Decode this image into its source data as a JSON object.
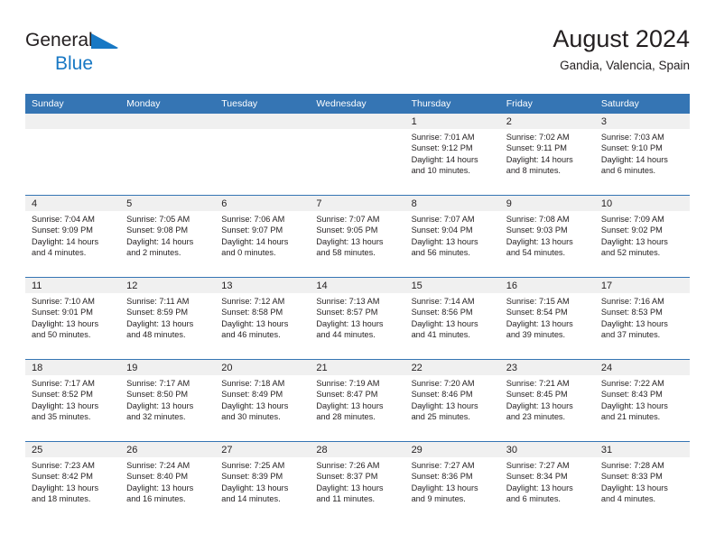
{
  "brand": {
    "name_part1": "General",
    "name_part2": "Blue",
    "triangle_icon": "blue-triangle-icon",
    "color_dark": "#231f20",
    "color_blue": "#1878c4"
  },
  "header": {
    "title": "August 2024",
    "subtitle": "Gandia, Valencia, Spain"
  },
  "theme": {
    "header_blue": "#3575b4",
    "date_strip_gray": "#f0f0f0",
    "text": "#231f20"
  },
  "weekdays": [
    "Sunday",
    "Monday",
    "Tuesday",
    "Wednesday",
    "Thursday",
    "Friday",
    "Saturday"
  ],
  "labels": {
    "sunrise": "Sunrise:",
    "sunset": "Sunset:",
    "daylight": "Daylight:"
  },
  "weeks": [
    [
      {
        "day": "",
        "empty": true
      },
      {
        "day": "",
        "empty": true
      },
      {
        "day": "",
        "empty": true
      },
      {
        "day": "",
        "empty": true
      },
      {
        "day": "1",
        "sunrise": "Sunrise: 7:01 AM",
        "sunset": "Sunset: 9:12 PM",
        "daylight_l1": "Daylight: 14 hours",
        "daylight_l2": "and 10 minutes."
      },
      {
        "day": "2",
        "sunrise": "Sunrise: 7:02 AM",
        "sunset": "Sunset: 9:11 PM",
        "daylight_l1": "Daylight: 14 hours",
        "daylight_l2": "and 8 minutes."
      },
      {
        "day": "3",
        "sunrise": "Sunrise: 7:03 AM",
        "sunset": "Sunset: 9:10 PM",
        "daylight_l1": "Daylight: 14 hours",
        "daylight_l2": "and 6 minutes."
      }
    ],
    [
      {
        "day": "4",
        "sunrise": "Sunrise: 7:04 AM",
        "sunset": "Sunset: 9:09 PM",
        "daylight_l1": "Daylight: 14 hours",
        "daylight_l2": "and 4 minutes."
      },
      {
        "day": "5",
        "sunrise": "Sunrise: 7:05 AM",
        "sunset": "Sunset: 9:08 PM",
        "daylight_l1": "Daylight: 14 hours",
        "daylight_l2": "and 2 minutes."
      },
      {
        "day": "6",
        "sunrise": "Sunrise: 7:06 AM",
        "sunset": "Sunset: 9:07 PM",
        "daylight_l1": "Daylight: 14 hours",
        "daylight_l2": "and 0 minutes."
      },
      {
        "day": "7",
        "sunrise": "Sunrise: 7:07 AM",
        "sunset": "Sunset: 9:05 PM",
        "daylight_l1": "Daylight: 13 hours",
        "daylight_l2": "and 58 minutes."
      },
      {
        "day": "8",
        "sunrise": "Sunrise: 7:07 AM",
        "sunset": "Sunset: 9:04 PM",
        "daylight_l1": "Daylight: 13 hours",
        "daylight_l2": "and 56 minutes."
      },
      {
        "day": "9",
        "sunrise": "Sunrise: 7:08 AM",
        "sunset": "Sunset: 9:03 PM",
        "daylight_l1": "Daylight: 13 hours",
        "daylight_l2": "and 54 minutes."
      },
      {
        "day": "10",
        "sunrise": "Sunrise: 7:09 AM",
        "sunset": "Sunset: 9:02 PM",
        "daylight_l1": "Daylight: 13 hours",
        "daylight_l2": "and 52 minutes."
      }
    ],
    [
      {
        "day": "11",
        "sunrise": "Sunrise: 7:10 AM",
        "sunset": "Sunset: 9:01 PM",
        "daylight_l1": "Daylight: 13 hours",
        "daylight_l2": "and 50 minutes."
      },
      {
        "day": "12",
        "sunrise": "Sunrise: 7:11 AM",
        "sunset": "Sunset: 8:59 PM",
        "daylight_l1": "Daylight: 13 hours",
        "daylight_l2": "and 48 minutes."
      },
      {
        "day": "13",
        "sunrise": "Sunrise: 7:12 AM",
        "sunset": "Sunset: 8:58 PM",
        "daylight_l1": "Daylight: 13 hours",
        "daylight_l2": "and 46 minutes."
      },
      {
        "day": "14",
        "sunrise": "Sunrise: 7:13 AM",
        "sunset": "Sunset: 8:57 PM",
        "daylight_l1": "Daylight: 13 hours",
        "daylight_l2": "and 44 minutes."
      },
      {
        "day": "15",
        "sunrise": "Sunrise: 7:14 AM",
        "sunset": "Sunset: 8:56 PM",
        "daylight_l1": "Daylight: 13 hours",
        "daylight_l2": "and 41 minutes."
      },
      {
        "day": "16",
        "sunrise": "Sunrise: 7:15 AM",
        "sunset": "Sunset: 8:54 PM",
        "daylight_l1": "Daylight: 13 hours",
        "daylight_l2": "and 39 minutes."
      },
      {
        "day": "17",
        "sunrise": "Sunrise: 7:16 AM",
        "sunset": "Sunset: 8:53 PM",
        "daylight_l1": "Daylight: 13 hours",
        "daylight_l2": "and 37 minutes."
      }
    ],
    [
      {
        "day": "18",
        "sunrise": "Sunrise: 7:17 AM",
        "sunset": "Sunset: 8:52 PM",
        "daylight_l1": "Daylight: 13 hours",
        "daylight_l2": "and 35 minutes."
      },
      {
        "day": "19",
        "sunrise": "Sunrise: 7:17 AM",
        "sunset": "Sunset: 8:50 PM",
        "daylight_l1": "Daylight: 13 hours",
        "daylight_l2": "and 32 minutes."
      },
      {
        "day": "20",
        "sunrise": "Sunrise: 7:18 AM",
        "sunset": "Sunset: 8:49 PM",
        "daylight_l1": "Daylight: 13 hours",
        "daylight_l2": "and 30 minutes."
      },
      {
        "day": "21",
        "sunrise": "Sunrise: 7:19 AM",
        "sunset": "Sunset: 8:47 PM",
        "daylight_l1": "Daylight: 13 hours",
        "daylight_l2": "and 28 minutes."
      },
      {
        "day": "22",
        "sunrise": "Sunrise: 7:20 AM",
        "sunset": "Sunset: 8:46 PM",
        "daylight_l1": "Daylight: 13 hours",
        "daylight_l2": "and 25 minutes."
      },
      {
        "day": "23",
        "sunrise": "Sunrise: 7:21 AM",
        "sunset": "Sunset: 8:45 PM",
        "daylight_l1": "Daylight: 13 hours",
        "daylight_l2": "and 23 minutes."
      },
      {
        "day": "24",
        "sunrise": "Sunrise: 7:22 AM",
        "sunset": "Sunset: 8:43 PM",
        "daylight_l1": "Daylight: 13 hours",
        "daylight_l2": "and 21 minutes."
      }
    ],
    [
      {
        "day": "25",
        "sunrise": "Sunrise: 7:23 AM",
        "sunset": "Sunset: 8:42 PM",
        "daylight_l1": "Daylight: 13 hours",
        "daylight_l2": "and 18 minutes."
      },
      {
        "day": "26",
        "sunrise": "Sunrise: 7:24 AM",
        "sunset": "Sunset: 8:40 PM",
        "daylight_l1": "Daylight: 13 hours",
        "daylight_l2": "and 16 minutes."
      },
      {
        "day": "27",
        "sunrise": "Sunrise: 7:25 AM",
        "sunset": "Sunset: 8:39 PM",
        "daylight_l1": "Daylight: 13 hours",
        "daylight_l2": "and 14 minutes."
      },
      {
        "day": "28",
        "sunrise": "Sunrise: 7:26 AM",
        "sunset": "Sunset: 8:37 PM",
        "daylight_l1": "Daylight: 13 hours",
        "daylight_l2": "and 11 minutes."
      },
      {
        "day": "29",
        "sunrise": "Sunrise: 7:27 AM",
        "sunset": "Sunset: 8:36 PM",
        "daylight_l1": "Daylight: 13 hours",
        "daylight_l2": "and 9 minutes."
      },
      {
        "day": "30",
        "sunrise": "Sunrise: 7:27 AM",
        "sunset": "Sunset: 8:34 PM",
        "daylight_l1": "Daylight: 13 hours",
        "daylight_l2": "and 6 minutes."
      },
      {
        "day": "31",
        "sunrise": "Sunrise: 7:28 AM",
        "sunset": "Sunset: 8:33 PM",
        "daylight_l1": "Daylight: 13 hours",
        "daylight_l2": "and 4 minutes."
      }
    ]
  ]
}
